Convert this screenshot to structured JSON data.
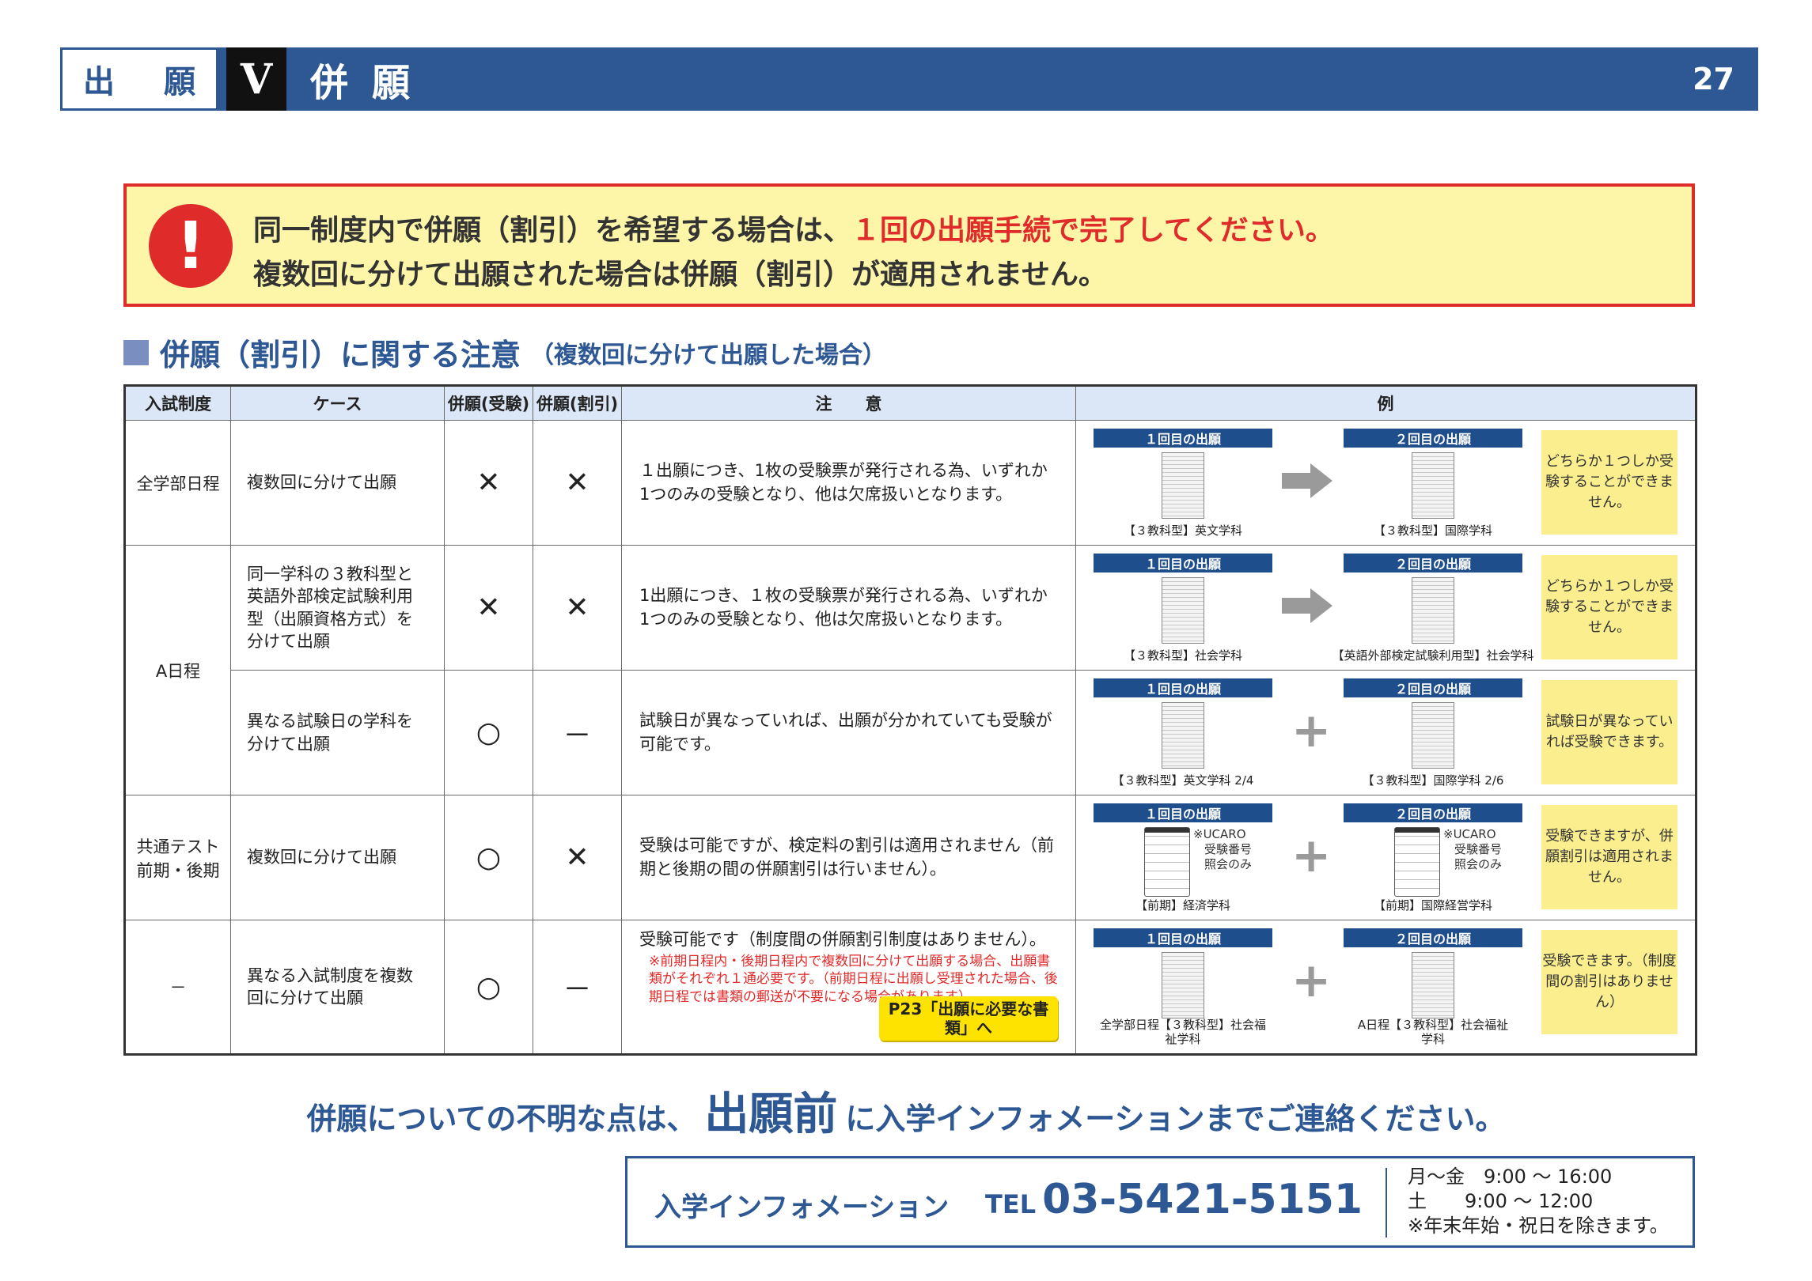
{
  "header": {
    "box_left": "出",
    "box_right": "願",
    "section_num": "V",
    "title": "併願",
    "page": "27"
  },
  "alert": {
    "icon": "!",
    "line1_black": "同一制度内で併願（割引）を希望する場合は、",
    "line1_red": "１回の出願手続で完了してください。",
    "line2": "複数回に分けて出願された場合は併願（割引）が適用されません。"
  },
  "section": {
    "title": "併願（割引）に関する注意",
    "subtitle": "（複数回に分けて出願した場合）"
  },
  "table": {
    "headers": [
      "入試制度",
      "ケース",
      "併願(受験)",
      "併願(割引)",
      "注　　意",
      "例"
    ],
    "tag1": "１回目の出願",
    "tag2": "２回目の出願",
    "ucaro": [
      "※UCARO",
      "受験番号",
      "照会のみ"
    ],
    "rows": [
      {
        "system": "全学部日程",
        "case": "複数回に分けて出願",
        "exam": "✕",
        "discount": "✕",
        "note": "１出願につき、1枚の受験票が発行される為、いずれか1つのみの受験となり、他は欠席扱いとなります。",
        "cap1": "【３教科型】英文学科",
        "cap2": "【３教科型】国際学科",
        "sticky": "どちらか１つしか受験することができません。"
      },
      {
        "system": "A日程",
        "case": "同一学科の３教科型と英語外部検定試験利用型（出願資格方式）を分けて出願",
        "exam": "✕",
        "discount": "✕",
        "note": "1出願につき、１枚の受験票が発行される為、いずれか1つのみの受験となり、他は欠席扱いとなります。",
        "cap1": "【３教科型】社会学科",
        "cap2": "【英語外部検定試験利用型】社会学科",
        "sticky": "どちらか１つしか受験することができません。"
      },
      {
        "case": "異なる試験日の学科を分けて出願",
        "exam": "○",
        "discount": "－",
        "note": "試験日が異なっていれば、出願が分かれていても受験が可能です。",
        "cap1": "【３教科型】英文学科 2/4",
        "cap2": "【３教科型】国際学科 2/6",
        "sticky": "試験日が異なっていれば受験できます。"
      },
      {
        "system": "共通テスト前期・後期",
        "case": "複数回に分けて出願",
        "exam": "○",
        "discount": "✕",
        "note": "受験は可能ですが、検定料の割引は適用されません（前期と後期の間の併願割引は行いません）。",
        "cap1": "【前期】経済学科",
        "cap2": "【前期】国際経営学科",
        "sticky": "受験できますが、併願割引は適用されません。"
      },
      {
        "system": "－",
        "case": "異なる入試制度を複数回に分けて出願",
        "exam": "○",
        "discount": "－",
        "note": "受験可能です（制度間の併願割引制度はありません）。",
        "note_red": "※前期日程内・後期日程内で複数回に分けて出願する場合、出願書類がそれぞれ１通必要です。（前期日程に出願し受理された場合、後期日程では書類の郵送が不要になる場合があります）",
        "p23": "P23「出願に必要な書類」へ",
        "cap1": "全学部日程【３教科型】社会福祉学科",
        "cap2": "A日程【３教科型】社会福祉学科",
        "sticky": "受験できます。（制度間の割引はありません）"
      }
    ]
  },
  "footer": {
    "text_a": "併願についての不明な点は、",
    "text_big": "出願前",
    "text_b": "に入学インフォメーションまでご連絡ください。",
    "contact_name": "入学インフォメーション",
    "tel_label": "TEL",
    "tel_number": "03-5421-5151",
    "hours1": "月～金　9:00 ～ 16:00",
    "hours2": "土　　9:00 ～ 12:00",
    "hours3": "※年末年始・祝日を除きます。"
  },
  "colors": {
    "brand_blue": "#2e5894",
    "alert_red": "#e02b2b",
    "alert_bg": "#fdf5a8",
    "sticky_yellow": "#fbee8e",
    "header_cell": "#dbe7f6"
  }
}
